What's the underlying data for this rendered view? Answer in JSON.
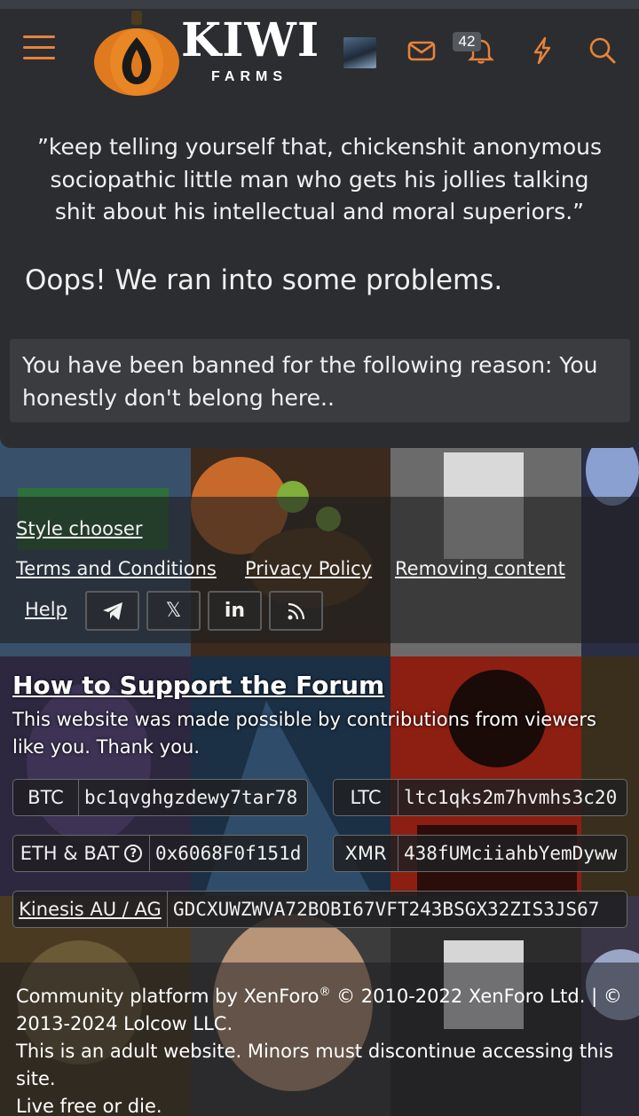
{
  "header": {
    "logo_title": "KIWI",
    "logo_subtitle": "FARMS",
    "alerts_count": "42"
  },
  "main": {
    "quote": "”keep telling yourself that, chickenshit anonymous sociopathic little man who gets his jollies talking shit about his intellectual and moral superiors.”",
    "error_title": "Oops! We ran into some problems.",
    "error_message": "You have been banned for the following reason: You honestly don't belong here.."
  },
  "footer": {
    "style_chooser": "Style chooser",
    "terms": "Terms and Conditions",
    "privacy": "Privacy Policy",
    "removing": "Removing content",
    "help": "Help",
    "social_x": "𝕏",
    "social_linkedin": "in"
  },
  "support": {
    "title": "How to Support the Forum",
    "text": "This website was made possible by contributions from viewers like you. Thank you.",
    "btc_label": "BTC",
    "btc_value": "bc1qvghgzdewy7tar78",
    "ltc_label": "LTC",
    "ltc_value": "ltc1qks2m7hvmhs3c20",
    "eth_label": "ETH & BAT",
    "eth_value": "0x6068F0f151d",
    "xmr_label": "XMR",
    "xmr_value": "438fUMciiahbYemDyww",
    "kinesis_label": "Kinesis AU / AG",
    "kinesis_value": "GDCXUWZWVA72BOBI67VFT243BSGX32ZIS3JS67"
  },
  "copyright": {
    "platform": "Community platform by XenForo",
    "reg": "®",
    "years": " © 2010-2022 XenForo Ltd. | © 2013-2024 Lolcow LLC.",
    "adult": "This is an adult website. Minors must discontinue accessing this site.",
    "motto": "Live free or die."
  },
  "colors": {
    "accent": "#e8823a",
    "panel": "#2b2d31",
    "error_box": "#3a3c40"
  }
}
